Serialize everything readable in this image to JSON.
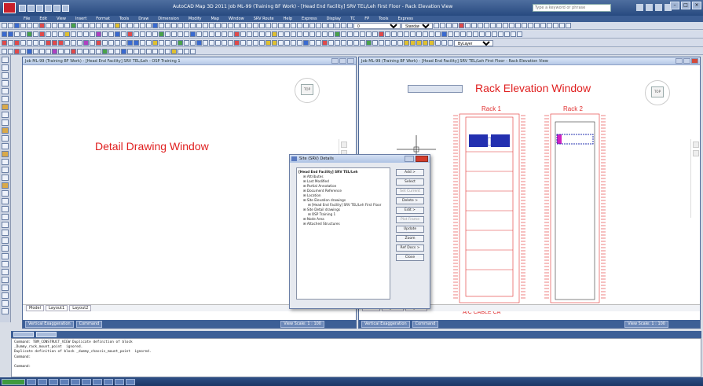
{
  "app": {
    "title": "AutoCAD Map 3D 2011   Job ML-99 (Training BF Work) - [Head End Facility] SRV TEL/Leh First Floor - Rack Elevation View",
    "search_placeholder": "Type a keyword or phrase"
  },
  "menu": [
    "File",
    "Edit",
    "View",
    "Insert",
    "Format",
    "Tools",
    "Draw",
    "Dimension",
    "Modify",
    "Map",
    "Window",
    "SRV Route",
    "Help",
    "Express",
    "Display",
    "TC",
    "FP",
    "Tools",
    "Express"
  ],
  "toolbar": {
    "layer_select": "0",
    "style_select": "Standard",
    "linetype_select": "ByLayer"
  },
  "detail_window": {
    "title": "Job ML-99 (Training BF Work) - [Head End Facility] SRV TEL/Leh - OSP Training 1",
    "label": "Detail Drawing Window",
    "tabs": [
      "Model",
      "Layout1",
      "Layout2"
    ],
    "status": [
      "Vertical Exaggeration",
      "Command"
    ],
    "scale": "View Scale: 1 : 100"
  },
  "rack_window": {
    "title": "Job ML-99 (Training BF Work) - [Head End Facility] SRV TEL/Leh First Floor - Rack Elevation View",
    "label": "Rack Elevation Window",
    "rack1_label": "Rack 1",
    "rack2_label": "Rack 2",
    "bottom_label": "A/C  CABLE  CA",
    "tabs": [
      "Model",
      "Layout1",
      "Layout2"
    ],
    "status": [
      "Vertical Exaggeration",
      "Command"
    ],
    "scale": "View Scale: 1 : 100"
  },
  "dialog": {
    "title": "Site (SRV) Details",
    "tree": [
      {
        "label": "[Head End Facility] SRV TEL/Leh",
        "indent": 0,
        "root": true
      },
      {
        "label": "Attributes",
        "indent": 1
      },
      {
        "label": "Last Modified",
        "indent": 1
      },
      {
        "label": "Partial Annotation",
        "indent": 1
      },
      {
        "label": "Document Reference",
        "indent": 1
      },
      {
        "label": "Location",
        "indent": 1
      },
      {
        "label": "Site Elevation drawings",
        "indent": 1
      },
      {
        "label": "[Head End Facility] SRV TEL/Leh First Floor",
        "indent": 2
      },
      {
        "label": "Site Detail drawings",
        "indent": 1
      },
      {
        "label": "OSP Training 1",
        "indent": 2
      },
      {
        "label": "Node Area",
        "indent": 1
      },
      {
        "label": "Attached Structures",
        "indent": 1
      }
    ],
    "buttons": [
      {
        "label": "Add >",
        "disabled": false
      },
      {
        "label": "Select",
        "disabled": false
      },
      {
        "label": "Set Current",
        "disabled": true
      },
      {
        "label": "Delete >",
        "disabled": false
      },
      {
        "label": "Edit >",
        "disabled": false
      },
      {
        "label": "Plot Frame",
        "disabled": true
      },
      {
        "label": "Update",
        "disabled": false
      },
      {
        "label": "Zoom",
        "disabled": false
      },
      {
        "label": "Ref Docs >",
        "disabled": false
      },
      {
        "label": "Close",
        "disabled": false
      }
    ]
  },
  "command_line": {
    "history": [
      "Command: TBM_CONSTRUCT_VIEW Duplicate definition of block",
      "_Dummy_rack_mount_point  ignored.",
      "Duplicate definition of block _dummy_chassis_mount_point  ignored.",
      "Command:",
      "",
      "Command:"
    ]
  },
  "colors": {
    "title_bar": "#274a80",
    "annotation_red": "#e02020",
    "rack_red": "#e03030",
    "equipment_blue": "#2330b0",
    "highlight_magenta": "#d020c0"
  }
}
